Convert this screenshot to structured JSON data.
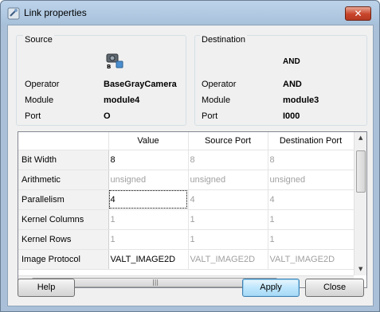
{
  "window": {
    "title": "Link properties",
    "close_glyph": "✕"
  },
  "source": {
    "title": "Source",
    "icon": "camera-operator-icon",
    "operator_label": "Operator",
    "operator_value": "BaseGrayCamera",
    "module_label": "Module",
    "module_value": "module4",
    "port_label": "Port",
    "port_value": "O"
  },
  "destination": {
    "title": "Destination",
    "icon_text": "AND",
    "operator_label": "Operator",
    "operator_value": "AND",
    "module_label": "Module",
    "module_value": "module3",
    "port_label": "Port",
    "port_value": "I000"
  },
  "table": {
    "columns": [
      "Value",
      "Source Port",
      "Destination Port"
    ],
    "rows": [
      {
        "name": "Bit Width",
        "value": "8",
        "source": "8",
        "dest": "8"
      },
      {
        "name": "Arithmetic",
        "value": "unsigned",
        "source": "unsigned",
        "dest": "unsigned"
      },
      {
        "name": "Parallelism",
        "value": "4",
        "source": "4",
        "dest": "4"
      },
      {
        "name": "Kernel Columns",
        "value": "1",
        "source": "1",
        "dest": "1"
      },
      {
        "name": "Kernel Rows",
        "value": "1",
        "source": "1",
        "dest": "1"
      },
      {
        "name": "Image Protocol",
        "value": "VALT_IMAGE2D",
        "source": "VALT_IMAGE2D",
        "dest": "VALT_IMAGE2D"
      }
    ]
  },
  "buttons": {
    "help": "Help",
    "apply": "Apply",
    "close": "Close"
  }
}
